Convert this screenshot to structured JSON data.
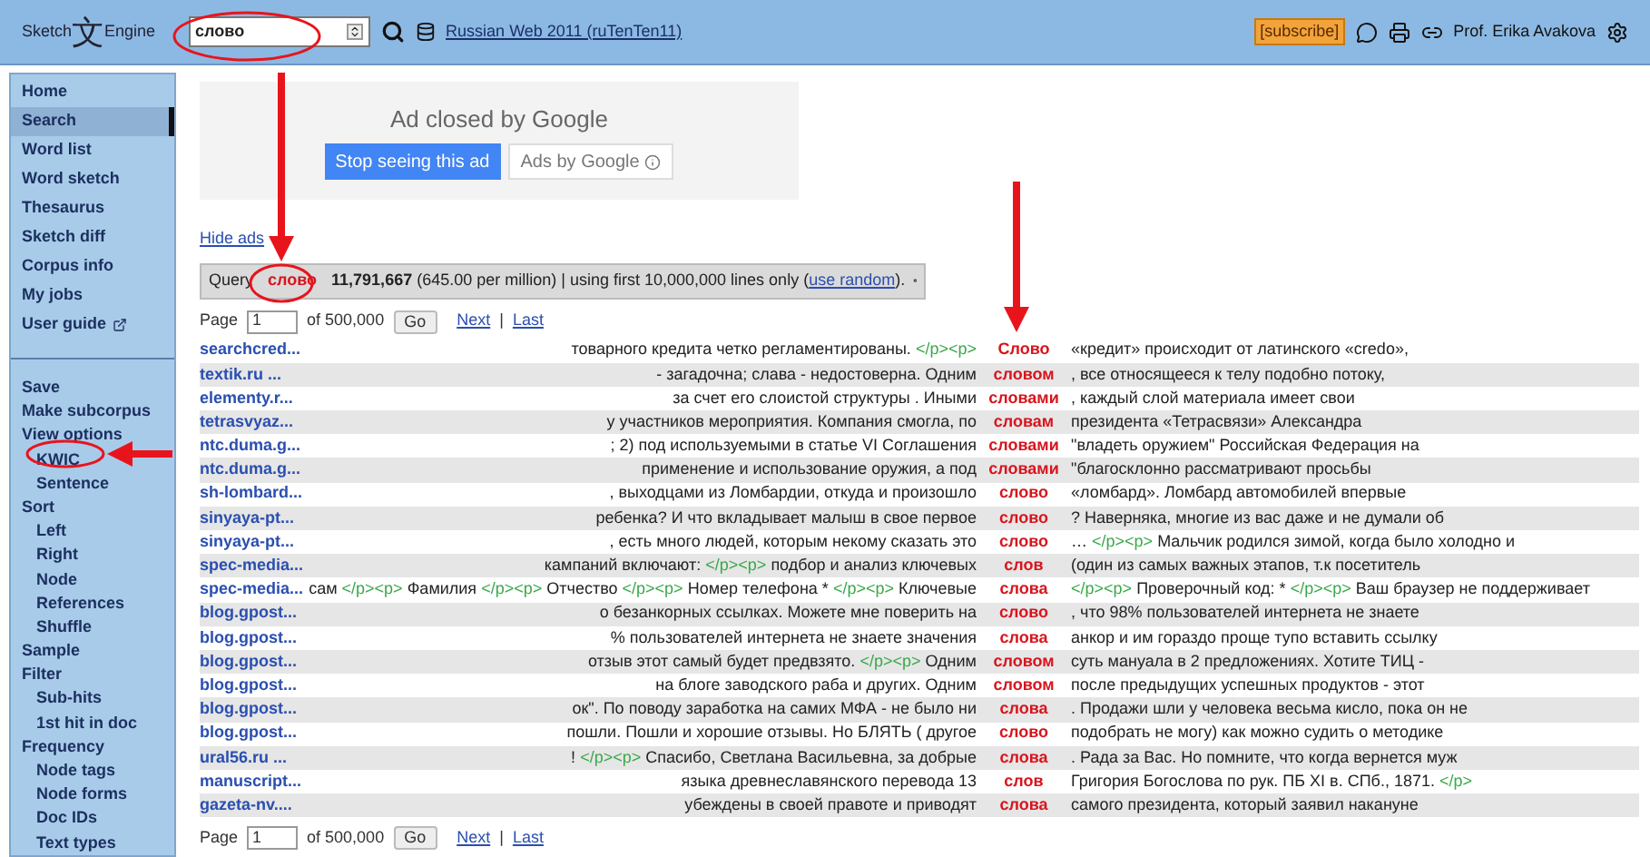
{
  "header": {
    "logo": {
      "left": "Sketch",
      "glyph": "文",
      "right": "Engine"
    },
    "search": {
      "value": "слово"
    },
    "corpus": "Russian Web 2011 (ruTenTen11)",
    "subscribe": "[subscribe]",
    "user": "Prof. Erika Avakova"
  },
  "sidebar": {
    "main": [
      {
        "label": "Home",
        "selected": false,
        "external": false
      },
      {
        "label": "Search",
        "selected": true,
        "external": false
      },
      {
        "label": "Word list",
        "selected": false,
        "external": false
      },
      {
        "label": "Word sketch",
        "selected": false,
        "external": false
      },
      {
        "label": "Thesaurus",
        "selected": false,
        "external": false
      },
      {
        "label": "Sketch diff",
        "selected": false,
        "external": false
      },
      {
        "label": "Corpus info",
        "selected": false,
        "external": false
      },
      {
        "label": "My jobs",
        "selected": false,
        "external": false
      },
      {
        "label": "User guide",
        "selected": false,
        "external": true
      }
    ],
    "tools": [
      {
        "label": "Save"
      },
      {
        "label": "Make subcorpus"
      },
      {
        "label": "View options",
        "children": [
          {
            "label": "KWIC"
          },
          {
            "label": "Sentence"
          }
        ]
      },
      {
        "label": "Sort",
        "children": [
          {
            "label": "Left"
          },
          {
            "label": "Right"
          },
          {
            "label": "Node"
          },
          {
            "label": "References"
          },
          {
            "label": "Shuffle"
          }
        ]
      },
      {
        "label": "Sample"
      },
      {
        "label": "Filter",
        "children": [
          {
            "label": "Sub-hits"
          },
          {
            "label": "1st hit in doc"
          }
        ]
      },
      {
        "label": "Frequency",
        "children": [
          {
            "label": "Node tags"
          },
          {
            "label": "Node forms"
          },
          {
            "label": "Doc IDs"
          },
          {
            "label": "Text types"
          }
        ]
      }
    ]
  },
  "ad": {
    "title": "Ad closed by Google",
    "stop": "Stop seeing this ad",
    "by": "Ads by Google"
  },
  "hide_ads": "Hide ads",
  "query": {
    "label": "Query",
    "term": "слово",
    "count": "11,791,667",
    "text": "(645.00 per million) | using first 10,000,000 lines only (",
    "link": "use random",
    "end": ")."
  },
  "pager_top": {
    "label": "Page",
    "page": "1",
    "of": "of 500,000",
    "go": "Go",
    "next": "Next",
    "separator": "|",
    "last": "Last"
  },
  "rows": [
    {
      "doc": "searchcred...",
      "left": [
        {
          "kind": "text",
          "text": "товарного кредита четко регламентированы."
        },
        {
          "kind": "tag",
          "text": "</p><p>"
        }
      ],
      "kwic": "Слово",
      "right": [
        {
          "kind": "text",
          "text": "«кредит» происходит от латинского «credo»,"
        }
      ]
    },
    {
      "doc": "textik.ru ...",
      "left": [
        {
          "kind": "text",
          "text": "- загадочна; слава - недостоверна. Одним"
        }
      ],
      "kwic": "словом",
      "right": [
        {
          "kind": "text",
          "text": ", все относящееся к телу подобно потоку,"
        }
      ]
    },
    {
      "doc": "elementy.r...",
      "left": [
        {
          "kind": "text",
          "text": "за счет его слоистой структуры . Иными"
        }
      ],
      "kwic": "словами",
      "right": [
        {
          "kind": "text",
          "text": ", каждый слой материала имеет свои"
        }
      ]
    },
    {
      "doc": "tetrasvyaz...",
      "left": [
        {
          "kind": "text",
          "text": "у участников мероприятия. Компания смогла, по"
        }
      ],
      "kwic": "словам",
      "right": [
        {
          "kind": "text",
          "text": "президента «Тетрасвязи» Александра"
        }
      ]
    },
    {
      "doc": "ntc.duma.g...",
      "left": [
        {
          "kind": "text",
          "text": "; 2) под используемыми в статье VI Соглашения"
        }
      ],
      "kwic": "словами",
      "right": [
        {
          "kind": "text",
          "text": "\"владеть оружием\" Российская Федерация на"
        }
      ]
    },
    {
      "doc": "ntc.duma.g...",
      "left": [
        {
          "kind": "text",
          "text": "применение и использование оружия, а под"
        }
      ],
      "kwic": "словами",
      "right": [
        {
          "kind": "text",
          "text": "\"благосклонно рассматривают просьбы"
        }
      ]
    },
    {
      "doc": "sh-lombard...",
      "left": [
        {
          "kind": "text",
          "text": ", выходцами из Ломбардии, откуда и произошло"
        }
      ],
      "kwic": "слово",
      "right": [
        {
          "kind": "text",
          "text": "«ломбард». Ломбард автомобилей впервые"
        }
      ]
    },
    {
      "doc": "sinyaya-pt...",
      "left": [
        {
          "kind": "text",
          "text": "ребенка? И что вкладывает малыш в свое первое"
        }
      ],
      "kwic": "слово",
      "right": [
        {
          "kind": "text",
          "text": "? Наверняка, многие из вас даже и не думали об"
        }
      ]
    },
    {
      "doc": "sinyaya-pt...",
      "left": [
        {
          "kind": "text",
          "text": ", есть много людей, которым некому сказать это"
        }
      ],
      "kwic": "слово",
      "right": [
        {
          "kind": "text",
          "text": "…"
        },
        {
          "kind": "tag",
          "text": "</p><p>"
        },
        {
          "kind": "text",
          "text": "Мальчик родился зимой, когда было холодно и"
        }
      ]
    },
    {
      "doc": "spec-media...",
      "left": [
        {
          "kind": "text",
          "text": "кампаний включают:"
        },
        {
          "kind": "tag",
          "text": "</p><p>"
        },
        {
          "kind": "text",
          "text": "подбор и анализ ключевых"
        }
      ],
      "kwic": "слов",
      "right": [
        {
          "kind": "text",
          "text": "(один из самых важных этапов, т.к посетитель"
        }
      ]
    },
    {
      "doc": "spec-media...",
      "left": [
        {
          "kind": "text",
          "text": "сам"
        },
        {
          "kind": "tag",
          "text": "</p><p>"
        },
        {
          "kind": "text",
          "text": "Фамилия"
        },
        {
          "kind": "tag",
          "text": "</p><p>"
        },
        {
          "kind": "text",
          "text": "Отчество"
        },
        {
          "kind": "tag",
          "text": "</p><p>"
        },
        {
          "kind": "text",
          "text": "Номер телефона *"
        },
        {
          "kind": "tag",
          "text": "</p><p>"
        },
        {
          "kind": "text",
          "text": "Ключевые"
        }
      ],
      "kwic": "слова",
      "right": [
        {
          "kind": "tag",
          "text": "</p><p>"
        },
        {
          "kind": "text",
          "text": "Проверочный код: *"
        },
        {
          "kind": "tag",
          "text": "</p><p>"
        },
        {
          "kind": "text",
          "text": "Ваш браузер не поддерживает"
        }
      ]
    },
    {
      "doc": "blog.gpost...",
      "left": [
        {
          "kind": "text",
          "text": "о безанкорных ссылках. Можете мне поверить на"
        }
      ],
      "kwic": "слово",
      "right": [
        {
          "kind": "text",
          "text": ", что 98% пользователей интернета не знаете"
        }
      ]
    },
    {
      "doc": "blog.gpost...",
      "left": [
        {
          "kind": "text",
          "text": "% пользователей интернета не знаете значения"
        }
      ],
      "kwic": "слова",
      "right": [
        {
          "kind": "text",
          "text": "анкор и им гораздо проще тупо вставить ссылку"
        }
      ]
    },
    {
      "doc": "blog.gpost...",
      "left": [
        {
          "kind": "text",
          "text": "отзыв этот самый будет предвзято."
        },
        {
          "kind": "tag",
          "text": "</p><p>"
        },
        {
          "kind": "text",
          "text": "Одним"
        }
      ],
      "kwic": "словом",
      "right": [
        {
          "kind": "text",
          "text": "суть мануала в 2 предложениях. Хотите ТИЦ -"
        }
      ]
    },
    {
      "doc": "blog.gpost...",
      "left": [
        {
          "kind": "text",
          "text": "на блоге заводского раба и других. Одним"
        }
      ],
      "kwic": "словом",
      "right": [
        {
          "kind": "text",
          "text": "после предыдущих успешных продуктов - этот"
        }
      ]
    },
    {
      "doc": "blog.gpost...",
      "left": [
        {
          "kind": "text",
          "text": "ок\". По поводу заработка на самих МФА - не было ни"
        }
      ],
      "kwic": "слова",
      "right": [
        {
          "kind": "text",
          "text": ". Продажи шли у человека весьма кисло, пока он не"
        }
      ]
    },
    {
      "doc": "blog.gpost...",
      "left": [
        {
          "kind": "text",
          "text": "пошли. Пошли и хорошие отзывы. Но БЛЯТЬ ( другое"
        }
      ],
      "kwic": "слово",
      "right": [
        {
          "kind": "text",
          "text": "подобрать не могу) как можно судить о методике"
        }
      ]
    },
    {
      "doc": "ural56.ru ...",
      "left": [
        {
          "kind": "text",
          "text": "!"
        },
        {
          "kind": "tag",
          "text": "</p><p>"
        },
        {
          "kind": "text",
          "text": "Спасибо, Светлана Васильевна, за добрые"
        }
      ],
      "kwic": "слова",
      "right": [
        {
          "kind": "text",
          "text": ". Рада за Вас. Но помните, что когда вернется муж"
        }
      ]
    },
    {
      "doc": "manuscript...",
      "left": [
        {
          "kind": "text",
          "text": "языка древнеславянского перевода 13"
        }
      ],
      "kwic": "слов",
      "right": [
        {
          "kind": "text",
          "text": "Григория Богослова по рук. ПБ XI в. СПб., 1871."
        },
        {
          "kind": "tag",
          "text": "</p>"
        }
      ]
    },
    {
      "doc": "gazeta-nv....",
      "left": [
        {
          "kind": "text",
          "text": "убеждены в своей правоте и приводят"
        }
      ],
      "kwic": "слова",
      "right": [
        {
          "kind": "text",
          "text": "самого президента, который заявил накануне"
        }
      ]
    }
  ],
  "pager_bottom": {
    "label": "Page",
    "page": "1",
    "of": "of 500,000",
    "go": "Go",
    "next": "Next",
    "separator": "|",
    "last": "Last"
  }
}
